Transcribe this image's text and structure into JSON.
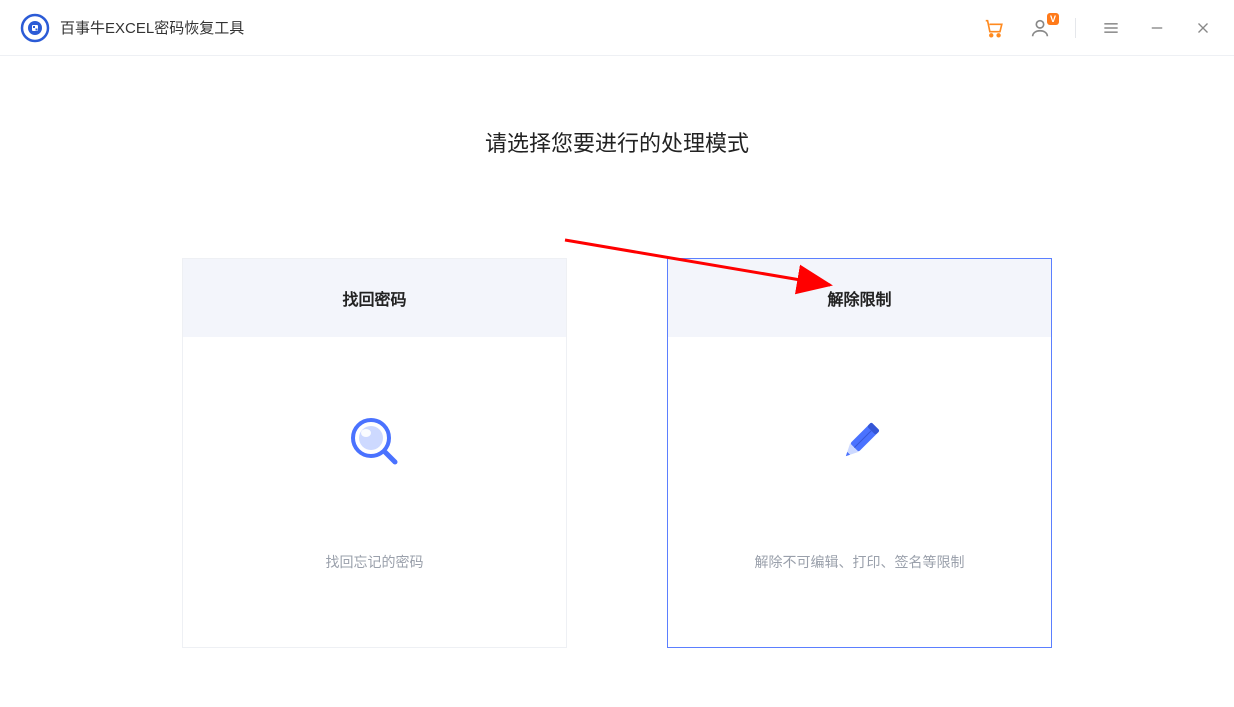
{
  "app": {
    "title": "百事牛EXCEL密码恢复工具"
  },
  "titlebar": {
    "vip_badge": "V"
  },
  "main": {
    "heading": "请选择您要进行的处理模式",
    "cards": [
      {
        "title": "找回密码",
        "description": "找回忘记的密码",
        "selected": false
      },
      {
        "title": "解除限制",
        "description": "解除不可编辑、打印、签名等限制",
        "selected": true
      }
    ]
  }
}
